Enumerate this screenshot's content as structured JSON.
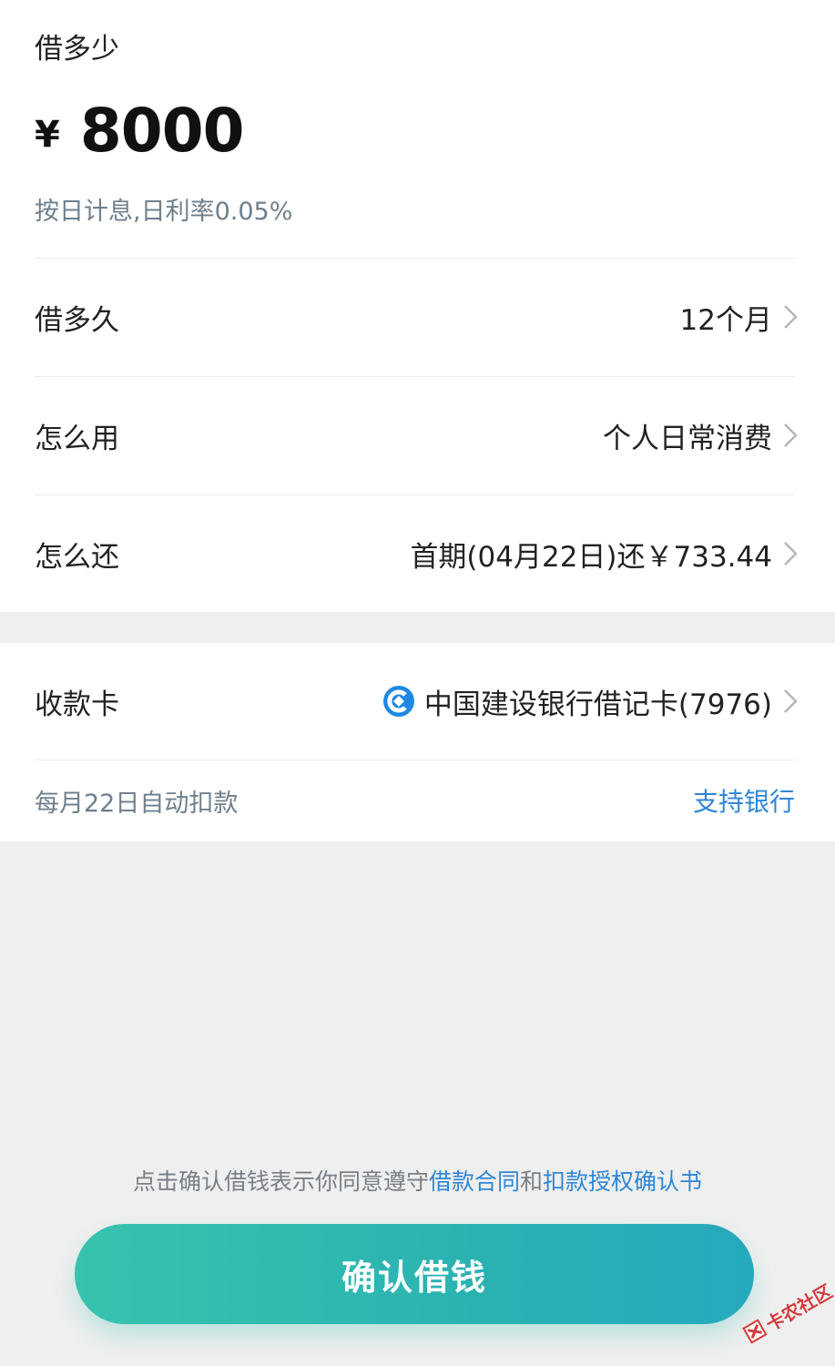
{
  "loan_amount": {
    "label": "借多少",
    "currency": "¥",
    "value": "8000",
    "interest_note": "按日计息,日利率0.05%"
  },
  "rows": [
    {
      "label": "借多久",
      "value": "12个月"
    },
    {
      "label": "怎么用",
      "value": "个人日常消费"
    },
    {
      "label": "怎么还",
      "value": "首期(04月22日)还￥733.44"
    }
  ],
  "receiving_card": {
    "label": "收款卡",
    "bank_name": "中国建设银行借记卡(7976)",
    "bank_icon": "ccb-logo-icon"
  },
  "autodebit": {
    "note": "每月22日自动扣款",
    "support_link": "支持银行"
  },
  "agreement": {
    "prefix": "点击确认借钱表示你同意遵守",
    "link1": "借款合同",
    "connector": "和",
    "link2": "扣款授权确认书"
  },
  "confirm_button": {
    "label": "确认借钱"
  },
  "watermark": {
    "text": "卡农社区"
  },
  "colors": {
    "accent_teal": "#2ab2b2",
    "link_blue": "#2f86d6",
    "bank_blue": "#1e88e5"
  }
}
